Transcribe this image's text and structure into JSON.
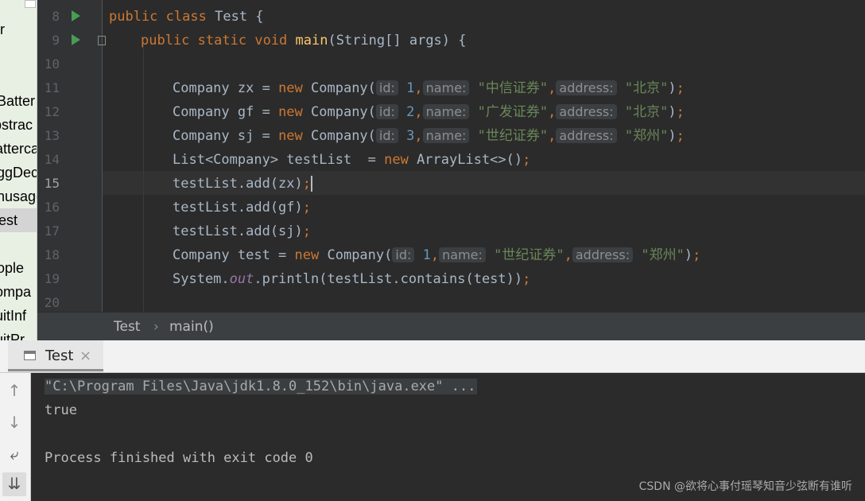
{
  "project_panel": {
    "items": [
      {
        "label": "r"
      },
      {
        "label": "Batter"
      },
      {
        "label": "bstrac"
      },
      {
        "label": "atterca"
      },
      {
        "label": "ggDec"
      },
      {
        "label": "nusage"
      },
      {
        "label": "est"
      },
      {
        "label": "ople"
      },
      {
        "label": "ompa"
      },
      {
        "label": "uitInf"
      },
      {
        "label": "uitPr"
      }
    ]
  },
  "editor": {
    "lines": [
      {
        "number": "8"
      },
      {
        "number": "9"
      },
      {
        "number": "10"
      },
      {
        "number": "11"
      },
      {
        "number": "12"
      },
      {
        "number": "13"
      },
      {
        "number": "14"
      },
      {
        "number": "15"
      },
      {
        "number": "16"
      },
      {
        "number": "17"
      },
      {
        "number": "18"
      },
      {
        "number": "19"
      },
      {
        "number": "20"
      }
    ],
    "code": {
      "l8": {
        "kw1": "public",
        "kw2": "class",
        "name": "Test {"
      },
      "l9": {
        "kw1": "public",
        "kw2": "static",
        "kw3": "void",
        "fn": "main",
        "rest": "(String[] args) {"
      },
      "l11": {
        "decl": "Company zx = ",
        "kw": "new",
        "ctor": " Company(",
        "h1": "id:",
        "v1": "1",
        "h2": "name:",
        "v2": "\"中信证券\"",
        "h3": "address:",
        "v3": "\"北京\"",
        "end": ")",
        "semi": ";"
      },
      "l12": {
        "decl": "Company gf = ",
        "kw": "new",
        "ctor": " Company(",
        "h1": "id:",
        "v1": "2",
        "h2": "name:",
        "v2": "\"广发证券\"",
        "h3": "address:",
        "v3": "\"北京\"",
        "end": ")",
        "semi": ";"
      },
      "l13": {
        "decl": "Company sj = ",
        "kw": "new",
        "ctor": " Company(",
        "h1": "id:",
        "v1": "3",
        "h2": "name:",
        "v2": "\"世纪证券\"",
        "h3": "address:",
        "v3": "\"郑州\"",
        "end": ")",
        "semi": ";"
      },
      "l14": {
        "decl": "List<Company> testList  = ",
        "kw": "new",
        "rest": " ArrayList<>()",
        "semi": ";"
      },
      "l15": {
        "text": "testList.add(zx)",
        "semi": ";"
      },
      "l16": {
        "text": "testList.add(gf)",
        "semi": ";"
      },
      "l17": {
        "text": "testList.add(sj)",
        "semi": ";"
      },
      "l18": {
        "decl": "Company test = ",
        "kw": "new",
        "ctor": " Company(",
        "h1": "id:",
        "v1": "1",
        "h2": "name:",
        "v2": "\"世纪证券\"",
        "h3": "address:",
        "v3": "\"郑州\"",
        "end": ")",
        "semi": ";"
      },
      "l19": {
        "pre": "System.",
        "field": "out",
        "post": ".println(testList.contains(test))",
        "semi": ";"
      }
    },
    "comma": ","
  },
  "breadcrumb": {
    "class": "Test",
    "separator": "›",
    "method": "main()"
  },
  "run_window": {
    "tab_label": "Test",
    "close_glyph": "×",
    "side_icons": {
      "up": "↑",
      "down": "↓",
      "wrap": "⤶",
      "scroll_end": "⇊"
    },
    "console_lines": [
      "\"C:\\Program Files\\Java\\jdk1.8.0_152\\bin\\java.exe\" ...",
      "true",
      "",
      "Process finished with exit code 0"
    ]
  },
  "watermark": "CSDN @欲将心事付瑶琴知音少弦断有谁听",
  "colors": {
    "keyword": "#cc7832",
    "method": "#ffc66d",
    "string": "#6a8759",
    "number": "#6897bb",
    "static_field": "#9876aa",
    "run_gutter": "#499c54"
  }
}
